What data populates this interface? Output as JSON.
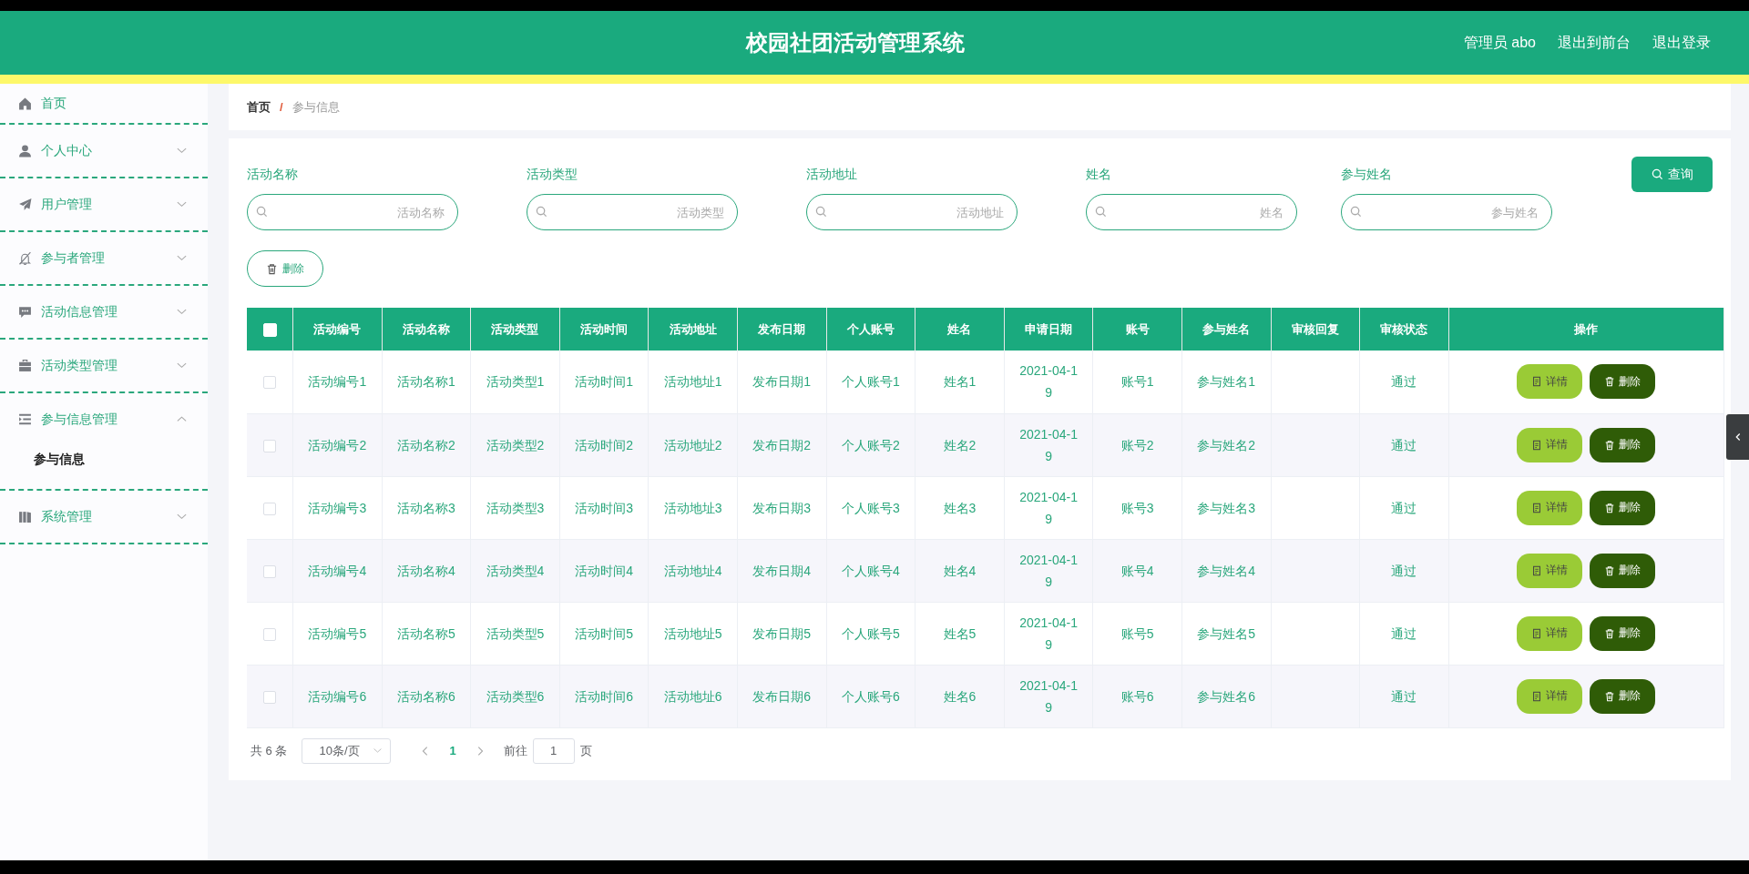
{
  "header": {
    "title": "校园社团活动管理系统",
    "links": [
      "管理员 abo",
      "退出到前台",
      "退出登录"
    ]
  },
  "sidebar": {
    "items": [
      {
        "label": "首页"
      },
      {
        "label": "个人中心",
        "expanded": false
      },
      {
        "label": "用户管理",
        "expanded": false
      },
      {
        "label": "参与者管理",
        "expanded": false
      },
      {
        "label": "活动信息管理",
        "expanded": false
      },
      {
        "label": "活动类型管理",
        "expanded": false
      },
      {
        "label": "参与信息管理",
        "expanded": true,
        "children": [
          {
            "label": "参与信息",
            "selected": true
          }
        ]
      },
      {
        "label": "系统管理",
        "expanded": false
      }
    ]
  },
  "breadcrumb": {
    "items": [
      "首页",
      "参与信息"
    ],
    "separator": "/"
  },
  "filters": [
    {
      "label": "活动名称",
      "placeholder": "活动名称"
    },
    {
      "label": "活动类型",
      "placeholder": "活动类型"
    },
    {
      "label": "活动地址",
      "placeholder": "活动地址"
    },
    {
      "label": "姓名",
      "placeholder": "姓名"
    },
    {
      "label": "参与姓名",
      "placeholder": "参与姓名"
    }
  ],
  "search_button": "查询",
  "delete_button": "删除",
  "table": {
    "all_checked": false,
    "columns": [
      "活动编号",
      "活动名称",
      "活动类型",
      "活动时间",
      "活动地址",
      "发布日期",
      "个人账号",
      "姓名",
      "申请日期",
      "账号",
      "参与姓名",
      "审核回复",
      "审核状态",
      "操作"
    ],
    "rows": [
      {
        "selected": false,
        "cells": [
          "活动编号1",
          "活动名称1",
          "活动类型1",
          "活动时间1",
          "活动地址1",
          "发布日期1",
          "个人账号1",
          "姓名1",
          "2021-04-19",
          "账号1",
          "参与姓名1",
          null,
          "通过"
        ],
        "actions": [
          "详情",
          "删除"
        ]
      },
      {
        "selected": false,
        "cells": [
          "活动编号2",
          "活动名称2",
          "活动类型2",
          "活动时间2",
          "活动地址2",
          "发布日期2",
          "个人账号2",
          "姓名2",
          "2021-04-19",
          "账号2",
          "参与姓名2",
          null,
          "通过"
        ],
        "actions": [
          "详情",
          "删除"
        ]
      },
      {
        "selected": false,
        "cells": [
          "活动编号3",
          "活动名称3",
          "活动类型3",
          "活动时间3",
          "活动地址3",
          "发布日期3",
          "个人账号3",
          "姓名3",
          "2021-04-19",
          "账号3",
          "参与姓名3",
          null,
          "通过"
        ],
        "actions": [
          "详情",
          "删除"
        ]
      },
      {
        "selected": false,
        "cells": [
          "活动编号4",
          "活动名称4",
          "活动类型4",
          "活动时间4",
          "活动地址4",
          "发布日期4",
          "个人账号4",
          "姓名4",
          "2021-04-19",
          "账号4",
          "参与姓名4",
          null,
          "通过"
        ],
        "actions": [
          "详情",
          "删除"
        ]
      },
      {
        "selected": false,
        "cells": [
          "活动编号5",
          "活动名称5",
          "活动类型5",
          "活动时间5",
          "活动地址5",
          "发布日期5",
          "个人账号5",
          "姓名5",
          "2021-04-19",
          "账号5",
          "参与姓名5",
          null,
          "通过"
        ],
        "actions": [
          "详情",
          "删除"
        ]
      },
      {
        "selected": false,
        "cells": [
          "活动编号6",
          "活动名称6",
          "活动类型6",
          "活动时间6",
          "活动地址6",
          "发布日期6",
          "个人账号6",
          "姓名6",
          "2021-04-19",
          "账号6",
          "参与姓名6",
          null,
          "通过"
        ],
        "actions": [
          "详情",
          "删除"
        ]
      }
    ]
  },
  "pagination": {
    "total": "共 6 条",
    "page_size": "10条/页",
    "pages": [
      {
        "label": "1",
        "selected": true
      }
    ],
    "goto_label": "前往",
    "goto_value": "1",
    "goto_suffix": "页"
  }
}
